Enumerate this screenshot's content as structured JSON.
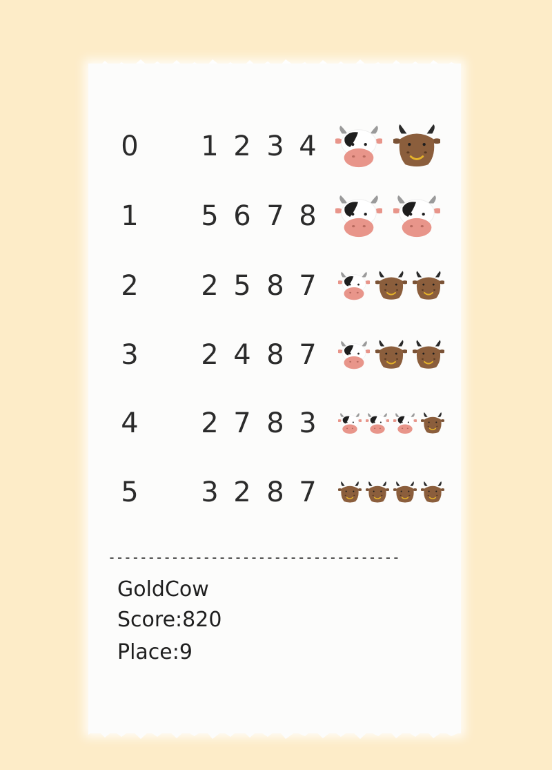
{
  "rows": [
    {
      "index": "0",
      "digits": [
        "1",
        "2",
        "3",
        "4"
      ],
      "result": [
        "spotted",
        "gold"
      ]
    },
    {
      "index": "1",
      "digits": [
        "5",
        "6",
        "7",
        "8"
      ],
      "result": [
        "spotted",
        "spotted"
      ]
    },
    {
      "index": "2",
      "digits": [
        "2",
        "5",
        "8",
        "7"
      ],
      "result": [
        "spotted",
        "gold",
        "gold"
      ]
    },
    {
      "index": "3",
      "digits": [
        "2",
        "4",
        "8",
        "7"
      ],
      "result": [
        "spotted",
        "gold",
        "gold"
      ]
    },
    {
      "index": "4",
      "digits": [
        "2",
        "7",
        "8",
        "3"
      ],
      "result": [
        "spotted",
        "spotted",
        "spotted",
        "gold"
      ]
    },
    {
      "index": "5",
      "digits": [
        "3",
        "2",
        "8",
        "7"
      ],
      "result": [
        "gold",
        "gold",
        "gold",
        "gold"
      ]
    }
  ],
  "divider": "-------------------------------------",
  "player": {
    "name": "GoldCow"
  },
  "score": {
    "label": "Score:",
    "value": "820"
  },
  "place": {
    "label": "Place:",
    "value": "9"
  },
  "colors": {
    "background": "#fdecc8",
    "paper": "#fcfcfb",
    "ink": "#2b2b2b",
    "gold_cow": "#8b5e3c",
    "spotted_cow_nose": "#e8958a"
  }
}
